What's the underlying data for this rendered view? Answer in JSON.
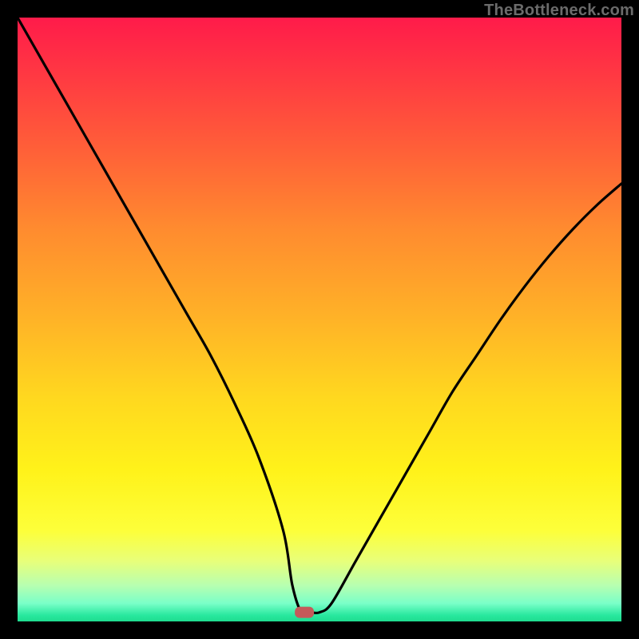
{
  "attribution": "TheBottleneck.com",
  "chart_data": {
    "type": "line",
    "title": "",
    "xlabel": "",
    "ylabel": "",
    "xlim": [
      0,
      100
    ],
    "ylim": [
      0,
      100
    ],
    "grid": false,
    "series": [
      {
        "name": "bottleneck-curve",
        "x": [
          0,
          4,
          8,
          12,
          16,
          20,
          24,
          28,
          32,
          36,
          40,
          44,
          45.5,
          47,
          48.5,
          50,
          52,
          56,
          60,
          64,
          68,
          72,
          76,
          80,
          84,
          88,
          92,
          96,
          100
        ],
        "y": [
          100,
          93,
          86,
          79,
          72,
          65,
          58,
          51,
          44,
          36,
          27,
          15,
          6,
          1.5,
          1.5,
          1.5,
          3,
          10,
          17,
          24,
          31,
          38,
          44,
          50,
          55.5,
          60.5,
          65,
          69,
          72.5
        ]
      }
    ],
    "marker": {
      "x": 47.5,
      "y": 1.5,
      "color": "#c55a5a"
    },
    "background_gradient": {
      "top": "#ff1b4a",
      "mid": "#ffd81f",
      "bottom": "#1fdc8f"
    }
  }
}
